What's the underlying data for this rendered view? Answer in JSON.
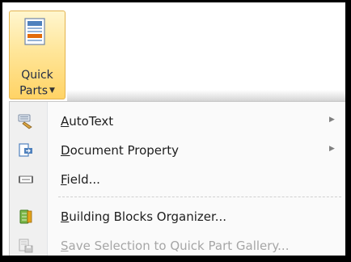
{
  "ribbon": {
    "quick_parts": {
      "label_line1": "Quick",
      "label_line2": "Parts",
      "icon": "quick-parts-icon"
    }
  },
  "menu": {
    "items": [
      {
        "label_pre": "",
        "label_ul": "A",
        "label_post": "utoText",
        "icon": "autotext-icon",
        "has_submenu": true,
        "enabled": true
      },
      {
        "label_pre": "",
        "label_ul": "D",
        "label_post": "ocument Property",
        "icon": "document-property-icon",
        "has_submenu": true,
        "enabled": true
      },
      {
        "label_pre": "",
        "label_ul": "F",
        "label_post": "ield...",
        "icon": "field-icon",
        "has_submenu": false,
        "enabled": true
      },
      {
        "label_pre": "",
        "label_ul": "B",
        "label_post": "uilding Blocks Organizer...",
        "icon": "building-blocks-icon",
        "has_submenu": false,
        "enabled": true
      },
      {
        "label_pre": "",
        "label_ul": "S",
        "label_post": "ave Selection to Quick Part Gallery...",
        "icon": "save-selection-icon",
        "has_submenu": false,
        "enabled": false
      }
    ],
    "submenu_arrow": "▶"
  },
  "colors": {
    "button_highlight": "#ffd365",
    "button_border": "#e3b34d",
    "disabled_text": "#a6a6a6"
  }
}
